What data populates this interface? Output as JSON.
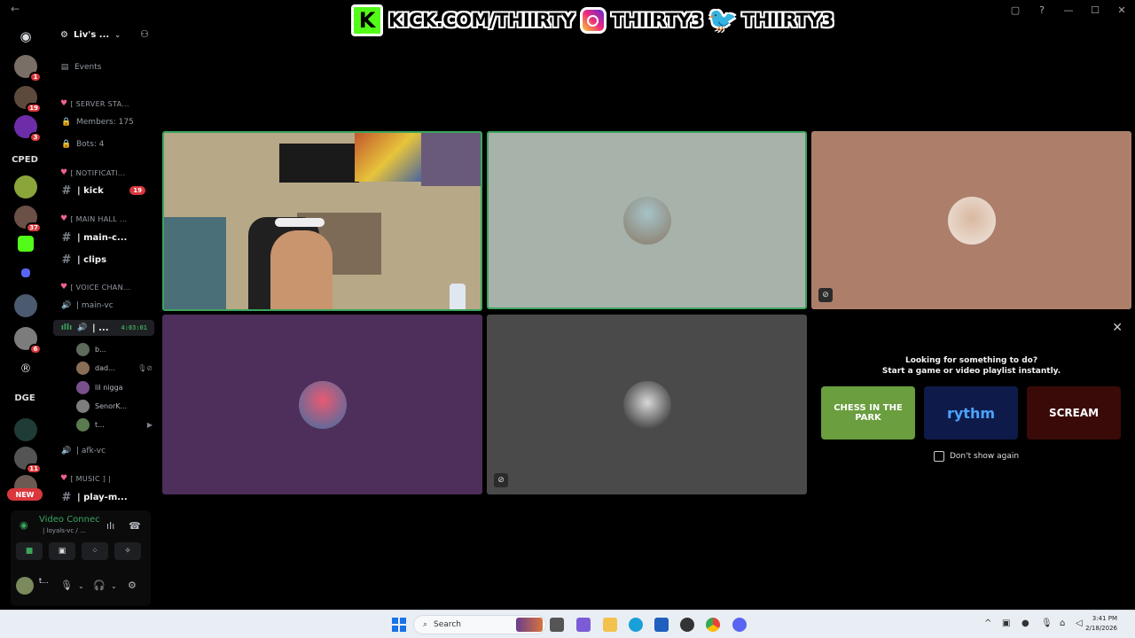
{
  "window": {
    "back": "←",
    "controls": [
      "▢",
      "?",
      "—",
      "☐",
      "✕"
    ]
  },
  "banner": {
    "kick_logo": "K",
    "kick_text": "KICK.COM/THIIRTY",
    "ig_text": "THIIRTY3",
    "tw_text": "THIIRTY3"
  },
  "rail": {
    "badges": [
      "1",
      "19",
      "3",
      "37",
      "6",
      "11"
    ],
    "labels": [
      "CPED",
      "DGE"
    ],
    "new_label": "NEW"
  },
  "server": {
    "name": "Liv's ...",
    "events_label": "Events"
  },
  "channels": {
    "cat_server_stats": "[ SERVER STA...",
    "members": "Members: 175",
    "bots": "Bots: 4",
    "cat_notifications": "[ NOTIFICATI...",
    "kick": "| kick",
    "kick_badge": "19",
    "cat_main_hall": "[ MAIN HALL ...",
    "main_chat": "| main-c...",
    "clips": "| clips",
    "cat_voice": "[ VOICE CHAN...",
    "main_vc": "| main-vc",
    "active_vc": "| ...",
    "active_timer": "4:03:01",
    "members_in_vc": [
      "b...",
      "dad...",
      "lil nigga",
      "SenorK...",
      "t..."
    ],
    "afk_vc": "| afk-vc",
    "cat_music": "[ MUSIC ] |",
    "play_music": "| play-m..."
  },
  "voice_panel": {
    "status": "Video Connec",
    "sub": "| loyals-vc / ...",
    "user": "t..."
  },
  "activity": {
    "line1": "Looking for something to do?",
    "line2": "Start a game or video playlist instantly.",
    "cards": [
      "CHESS IN THE PARK",
      "rythm",
      "SCREAM"
    ],
    "dont_show": "Don't show again"
  },
  "taskbar": {
    "search_placeholder": "Search",
    "time": "3:41 PM",
    "date": "2/18/2026"
  },
  "colors": {
    "accent_green": "#3ba55d",
    "badge_red": "#da373c",
    "kick_green": "#53fc18"
  }
}
